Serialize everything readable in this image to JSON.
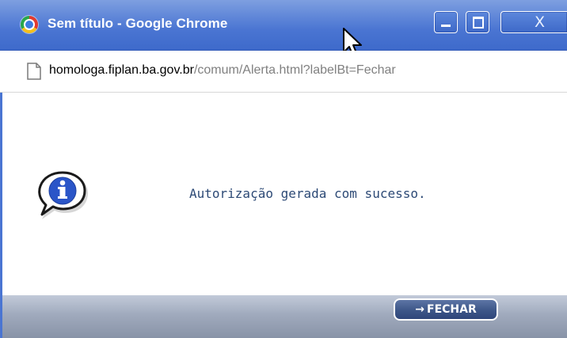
{
  "window": {
    "title": "Sem título - Google Chrome",
    "icons": {
      "app": "chrome-logo-icon",
      "minimize": "minimize-icon",
      "maximize": "maximize-icon",
      "close": "close-icon",
      "cursor": "mouse-cursor-icon"
    },
    "close_glyph": "X"
  },
  "address_bar": {
    "icon": "page-icon",
    "url_host": "homologa.fiplan.ba.gov.br",
    "url_path": "/comum/Alerta.html?labelBt=Fechar"
  },
  "alert": {
    "icon": "info-icon",
    "message": "Autorização gerada com sucesso."
  },
  "footer": {
    "button_arrow": "→",
    "button_label": "FECHAR"
  },
  "colors": {
    "titlebar": "#4a75d2",
    "message_text": "#2d4a76",
    "button_bg": "#3d5688",
    "footer_bg": "#a0aabd"
  }
}
